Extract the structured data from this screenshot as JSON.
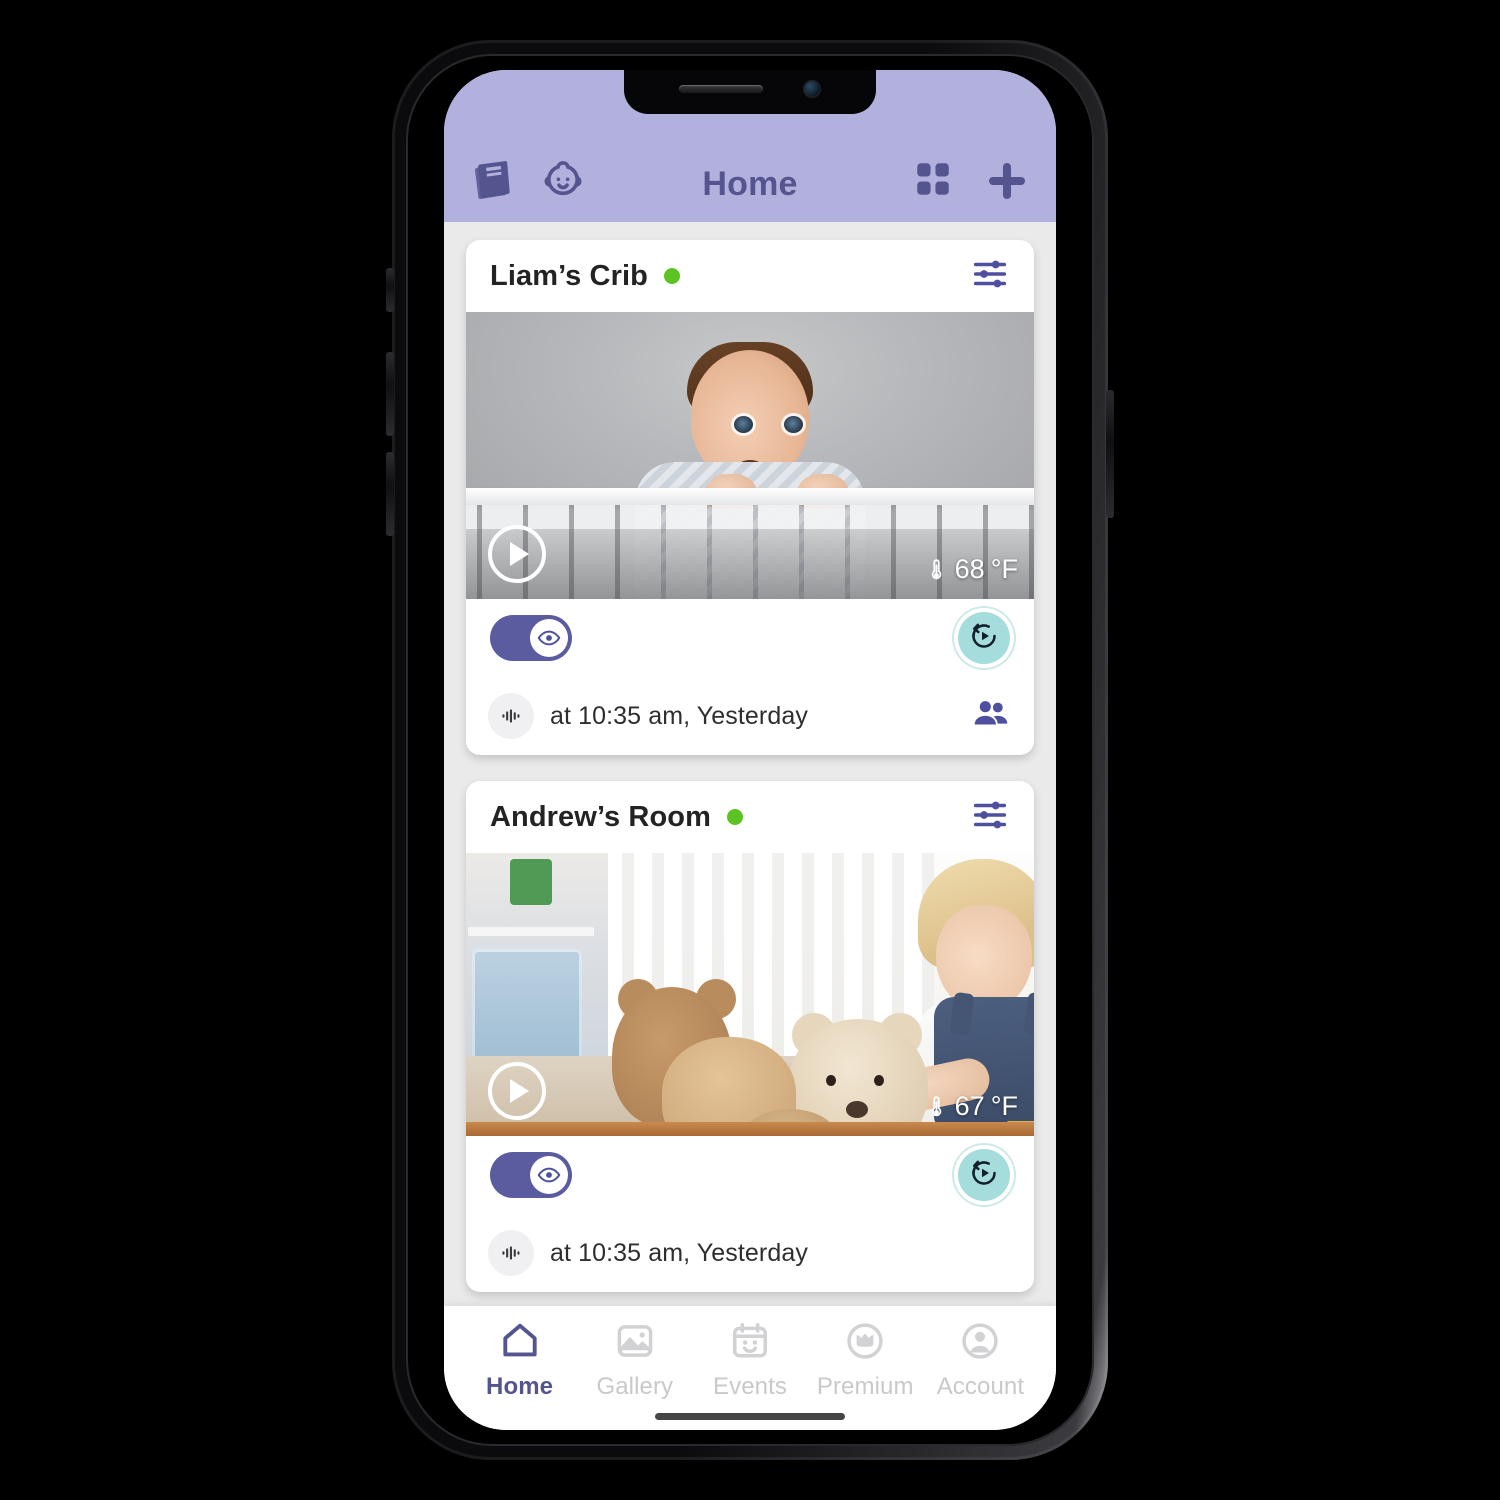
{
  "app": {
    "header": {
      "title": "Home",
      "left_icons": [
        {
          "name": "book-icon",
          "label": "Book"
        },
        {
          "name": "baby-face-icon",
          "label": "Baby"
        }
      ],
      "right_icons": [
        {
          "name": "grid-view-icon",
          "label": "Grid view"
        },
        {
          "name": "add-camera-icon",
          "label": "Add"
        }
      ],
      "background_color": "#B2B1DD",
      "title_color": "#54548F"
    },
    "cards": [
      {
        "title": "Liam’s Crib",
        "status": "online",
        "status_color": "#5BC322",
        "settings_icon": "sliders-icon",
        "play_icon": "play-icon",
        "temperature": "68",
        "temperature_unit": "°F",
        "thermometer_icon": "thermometer-icon",
        "monitor_toggle": {
          "state": "on",
          "icon": "eye-icon"
        },
        "replay_button": {
          "icon": "replay-icon",
          "color": "#A5DCDC"
        },
        "audio_icon": "audio-waveform-icon",
        "last_event": "at 10:35 am, Yesterday",
        "share_icon": "people-icon"
      },
      {
        "title": "Andrew’s Room",
        "status": "online",
        "status_color": "#5BC322",
        "settings_icon": "sliders-icon",
        "play_icon": "play-icon",
        "temperature": "67",
        "temperature_unit": "°F",
        "thermometer_icon": "thermometer-icon",
        "monitor_toggle": {
          "state": "on",
          "icon": "eye-icon"
        },
        "replay_button": {
          "icon": "replay-icon",
          "color": "#A5DCDC"
        },
        "audio_icon": "audio-waveform-icon",
        "last_event": "at 10:35 am, Yesterday",
        "share_icon": "people-icon"
      }
    ],
    "tabbar": {
      "active_color": "#54548F",
      "inactive_color": "#C9C9CC",
      "items": [
        {
          "label": "Home",
          "icon": "home-icon",
          "active": true
        },
        {
          "label": "Gallery",
          "icon": "gallery-icon",
          "active": false
        },
        {
          "label": "Events",
          "icon": "events-icon",
          "active": false
        },
        {
          "label": "Premium",
          "icon": "premium-icon",
          "active": false
        },
        {
          "label": "Account",
          "icon": "account-icon",
          "active": false
        }
      ]
    }
  }
}
